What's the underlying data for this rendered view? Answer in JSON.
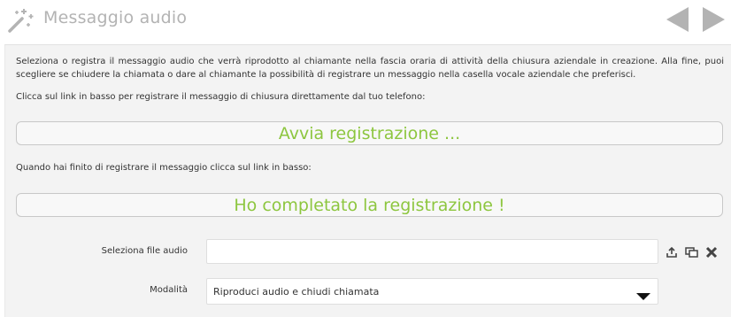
{
  "header": {
    "title": "Messaggio audio",
    "wand_icon": "magic-wand-icon",
    "prev_icon": "triangle-left-icon",
    "next_icon": "triangle-right-icon"
  },
  "panel": {
    "description": "Seleziona o registra il messaggio audio che verrà riprodotto al chiamante nella fascia oraria di attività della chiusura aziendale in creazione. Alla fine, puoi scegliere se chiudere la chiamata o dare al chiamante la possibilità di registrare un messaggio nella casella vocale aziendale che preferisci.",
    "record_hint": "Clicca sul link in basso per registrare il messaggio di chiusura direttamente dal tuo telefono:",
    "start_recording_label": "Avvia registrazione ...",
    "done_hint": "Quando hai finito di registrare il messaggio clicca sul link in basso:",
    "done_recording_label": "Ho completato la registrazione !",
    "file_label": "Seleziona file audio",
    "file_value": "",
    "file_icons": [
      "upload-icon",
      "copy-icon",
      "close-icon"
    ],
    "mode_label": "Modalità",
    "mode_value": "Riproduci audio e chiudi chiamata"
  },
  "colors": {
    "accent_green": "#8dc63f",
    "title_gray": "#b3b3b3",
    "panel_bg": "#f3f3f3"
  }
}
